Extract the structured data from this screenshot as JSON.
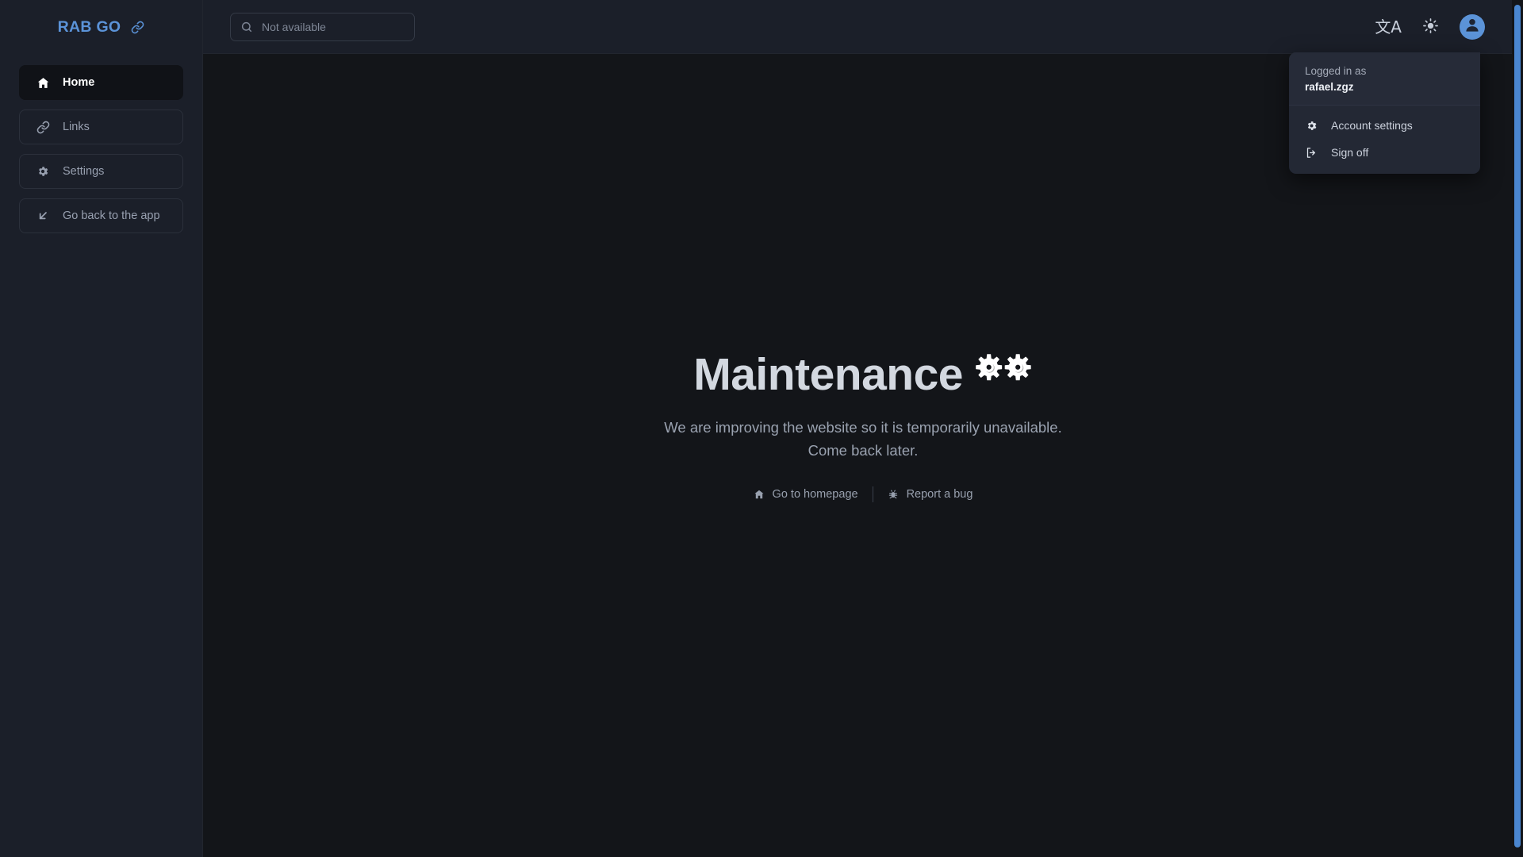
{
  "sidebar": {
    "brand": {
      "text": "RAB GO",
      "icon": "link-icon"
    },
    "items": [
      {
        "label": "Home",
        "icon": "home-icon",
        "active": true
      },
      {
        "label": "Links",
        "icon": "link-icon",
        "active": false
      },
      {
        "label": "Settings",
        "icon": "gear-icon",
        "active": false
      },
      {
        "label": "Go back to the app",
        "icon": "arrow-down-left-icon",
        "active": false
      }
    ]
  },
  "topbar": {
    "search": {
      "value": "",
      "placeholder": "Not available",
      "icon": "search-icon"
    },
    "actions": [
      {
        "name": "translate-button",
        "icon": "translate-icon",
        "glyph": "文A"
      },
      {
        "name": "theme-toggle-button",
        "icon": "sun-icon"
      },
      {
        "name": "account-avatar-button",
        "icon": "user-avatar-icon"
      }
    ]
  },
  "user_menu": {
    "logged_in_label": "Logged in as",
    "username": "rafael.zgz",
    "items": [
      {
        "label": "Account settings",
        "icon": "gear-icon"
      },
      {
        "label": "Sign off",
        "icon": "sign-out-icon"
      }
    ]
  },
  "maintenance": {
    "title": "Maintenance",
    "gears": "⚙️⚙️",
    "message_line1": "We are improving the website so it is temporarily unavailable.",
    "message_line2": "Come back later.",
    "links": [
      {
        "label": "Go to homepage",
        "icon": "home-icon"
      },
      {
        "label": "Report a bug",
        "icon": "bug-icon"
      }
    ]
  },
  "colors": {
    "accent_blue": "#5b93d8",
    "sidebar_bg": "#1b1f29",
    "content_bg": "#131519",
    "menu_bg": "#232834",
    "scrollbar": "#4a86d0"
  }
}
